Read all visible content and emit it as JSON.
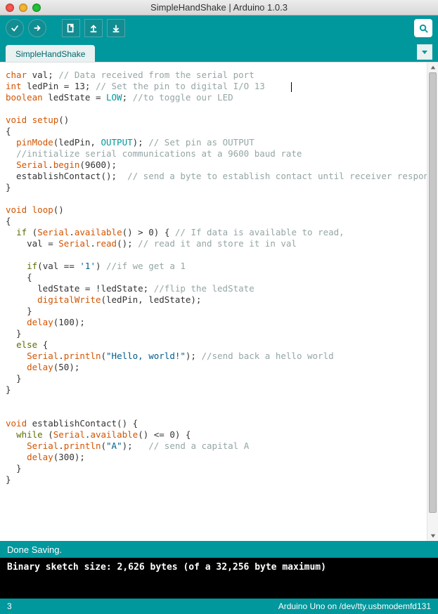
{
  "window": {
    "title": "SimpleHandShake | Arduino 1.0.3"
  },
  "tab": {
    "label": "SimpleHandShake"
  },
  "status": {
    "message": "Done Saving."
  },
  "console": {
    "line1": "Binary sketch size: 2,626 bytes (of a 32,256 byte maximum)"
  },
  "footer": {
    "line": "3",
    "board": "Arduino Uno on /dev/tty.usbmodemfd131"
  },
  "code": {
    "l1_t1": "char",
    "l1_t2": " val; ",
    "l1_c": "// Data received from the serial port",
    "l2_t1": "int",
    "l2_t2": " ledPin = ",
    "l2_t3": "13",
    "l2_t4": "; ",
    "l2_c": "// Set the pin to digital I/O 13",
    "l3_t1": "boolean",
    "l3_t2": " ledState = ",
    "l3_t3": "LOW",
    "l3_t4": "; ",
    "l3_c": "//to toggle our LED",
    "l5_t1": "void",
    "l5_t2": " ",
    "l5_t3": "setup",
    "l5_t4": "()",
    "l6": "{",
    "l7_t1": "  ",
    "l7_t2": "pinMode",
    "l7_t3": "(ledPin, ",
    "l7_t4": "OUTPUT",
    "l7_t5": "); ",
    "l7_c": "// Set pin as OUTPUT",
    "l8_t1": "  ",
    "l8_c": "//initialize serial communications at a 9600 baud rate",
    "l9_t1": "  ",
    "l9_t2": "Serial",
    "l9_t3": ".",
    "l9_t4": "begin",
    "l9_t5": "(9600);",
    "l10_t1": "  establishContact();  ",
    "l10_c": "// send a byte to establish contact until receiver responds",
    "l11": "}",
    "l13_t1": "void",
    "l13_t2": " ",
    "l13_t3": "loop",
    "l13_t4": "()",
    "l14": "{",
    "l15_t1": "  ",
    "l15_t2": "if",
    "l15_t3": " (",
    "l15_t4": "Serial",
    "l15_t5": ".",
    "l15_t6": "available",
    "l15_t7": "() > 0) { ",
    "l15_c": "// If data is available to read,",
    "l16_t1": "    val = ",
    "l16_t2": "Serial",
    "l16_t3": ".",
    "l16_t4": "read",
    "l16_t5": "(); ",
    "l16_c": "// read it and store it in val",
    "l18_t1": "    ",
    "l18_t2": "if",
    "l18_t3": "(val == ",
    "l18_t4": "'1'",
    "l18_t5": ") ",
    "l18_c": "//if we get a 1",
    "l19": "    {",
    "l20_t1": "      ledState = !ledState; ",
    "l20_c": "//flip the ledState",
    "l21_t1": "      ",
    "l21_t2": "digitalWrite",
    "l21_t3": "(ledPin, ledState);",
    "l22": "    }",
    "l23_t1": "    ",
    "l23_t2": "delay",
    "l23_t3": "(100);",
    "l24": "  }",
    "l25_t1": "  ",
    "l25_t2": "else",
    "l25_t3": " {",
    "l26_t1": "    ",
    "l26_t2": "Serial",
    "l26_t3": ".",
    "l26_t4": "println",
    "l26_t5": "(",
    "l26_t6": "\"Hello, world!\"",
    "l26_t7": "); ",
    "l26_c": "//send back a hello world",
    "l27_t1": "    ",
    "l27_t2": "delay",
    "l27_t3": "(50);",
    "l28": "  }",
    "l29": "}",
    "l32_t1": "void",
    "l32_t2": " establishContact() {",
    "l33_t1": "  ",
    "l33_t2": "while",
    "l33_t3": " (",
    "l33_t4": "Serial",
    "l33_t5": ".",
    "l33_t6": "available",
    "l33_t7": "() <= 0) {",
    "l34_t1": "    ",
    "l34_t2": "Serial",
    "l34_t3": ".",
    "l34_t4": "println",
    "l34_t5": "(",
    "l34_t6": "\"A\"",
    "l34_t7": ");   ",
    "l34_c": "// send a capital A",
    "l35_t1": "    ",
    "l35_t2": "delay",
    "l35_t3": "(300);",
    "l36": "  }",
    "l37": "}"
  }
}
